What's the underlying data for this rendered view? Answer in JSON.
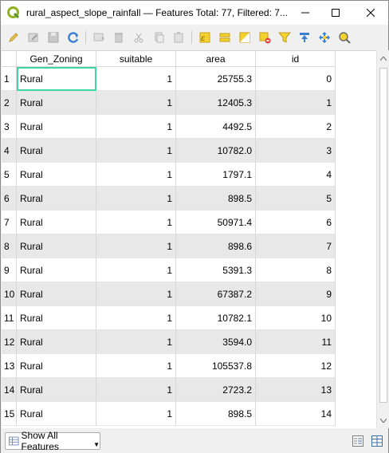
{
  "window": {
    "title": "rural_aspect_slope_rainfall — Features Total: 77, Filtered: 7..."
  },
  "toolbar": {
    "icons": [
      "edit-pencil-icon",
      "multi-edit-icon",
      "save-icon",
      "reload-icon",
      "add-feature-icon",
      "delete-icon",
      "cut-icon",
      "copy-icon",
      "paste-icon",
      "select-expression-icon",
      "select-all-icon",
      "invert-selection-icon",
      "deselect-icon",
      "filter-icon",
      "move-selection-top-icon",
      "pan-to-selection-icon",
      "zoom-to-selection-icon"
    ]
  },
  "table": {
    "columns": [
      "Gen_Zoning",
      "suitable",
      "area",
      "id"
    ],
    "rows": [
      {
        "n": "1",
        "zoning": "Rural",
        "suitable": "1",
        "area": "25755.3",
        "id": "0"
      },
      {
        "n": "2",
        "zoning": "Rural",
        "suitable": "1",
        "area": "12405.3",
        "id": "1"
      },
      {
        "n": "3",
        "zoning": "Rural",
        "suitable": "1",
        "area": "4492.5",
        "id": "2"
      },
      {
        "n": "4",
        "zoning": "Rural",
        "suitable": "1",
        "area": "10782.0",
        "id": "3"
      },
      {
        "n": "5",
        "zoning": "Rural",
        "suitable": "1",
        "area": "1797.1",
        "id": "4"
      },
      {
        "n": "6",
        "zoning": "Rural",
        "suitable": "1",
        "area": "898.5",
        "id": "5"
      },
      {
        "n": "7",
        "zoning": "Rural",
        "suitable": "1",
        "area": "50971.4",
        "id": "6"
      },
      {
        "n": "8",
        "zoning": "Rural",
        "suitable": "1",
        "area": "898.6",
        "id": "7"
      },
      {
        "n": "9",
        "zoning": "Rural",
        "suitable": "1",
        "area": "5391.3",
        "id": "8"
      },
      {
        "n": "10",
        "zoning": "Rural",
        "suitable": "1",
        "area": "67387.2",
        "id": "9"
      },
      {
        "n": "11",
        "zoning": "Rural",
        "suitable": "1",
        "area": "10782.1",
        "id": "10"
      },
      {
        "n": "12",
        "zoning": "Rural",
        "suitable": "1",
        "area": "3594.0",
        "id": "11"
      },
      {
        "n": "13",
        "zoning": "Rural",
        "suitable": "1",
        "area": "105537.8",
        "id": "12"
      },
      {
        "n": "14",
        "zoning": "Rural",
        "suitable": "1",
        "area": "2723.2",
        "id": "13"
      },
      {
        "n": "15",
        "zoning": "Rural",
        "suitable": "1",
        "area": "898.5",
        "id": "14"
      }
    ]
  },
  "bottom": {
    "show_label": "Show All Features"
  },
  "colors": {
    "selection": "#3fd8a0",
    "alt_row": "#e8e8e8"
  }
}
